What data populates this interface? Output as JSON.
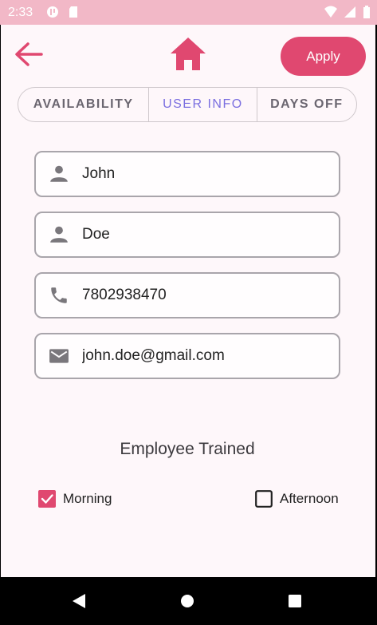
{
  "status_bar": {
    "time": "2:33",
    "left_icons": [
      "badge-icon",
      "sd-card-icon"
    ],
    "right_icons": [
      "wifi-icon",
      "signal-icon",
      "battery-icon"
    ]
  },
  "app_bar": {
    "back_icon": "arrow-back-icon",
    "home_icon": "home-icon",
    "apply_label": "Apply"
  },
  "tabs": [
    {
      "label": "AVAILABILITY",
      "active": false
    },
    {
      "label": "USER INFO",
      "active": true
    },
    {
      "label": "DAYS OFF",
      "active": false
    }
  ],
  "form": {
    "first_name": {
      "icon": "person-icon",
      "value": "John"
    },
    "last_name": {
      "icon": "person-icon",
      "value": "Doe"
    },
    "phone": {
      "icon": "phone-icon",
      "value": "7802938470"
    },
    "email": {
      "icon": "email-icon",
      "value": "john.doe@gmail.com"
    }
  },
  "trained": {
    "title": "Employee Trained",
    "options": [
      {
        "label": "Morning",
        "checked": true
      },
      {
        "label": "Afternoon",
        "checked": false
      }
    ]
  },
  "colors": {
    "accent": "#e04870",
    "status_bar": "#f2b8c7",
    "tab_active": "#7b6fe0",
    "background": "#fef7fa"
  },
  "nav_bar": {
    "icons": [
      "back-triangle-icon",
      "home-circle-icon",
      "recents-square-icon"
    ]
  }
}
